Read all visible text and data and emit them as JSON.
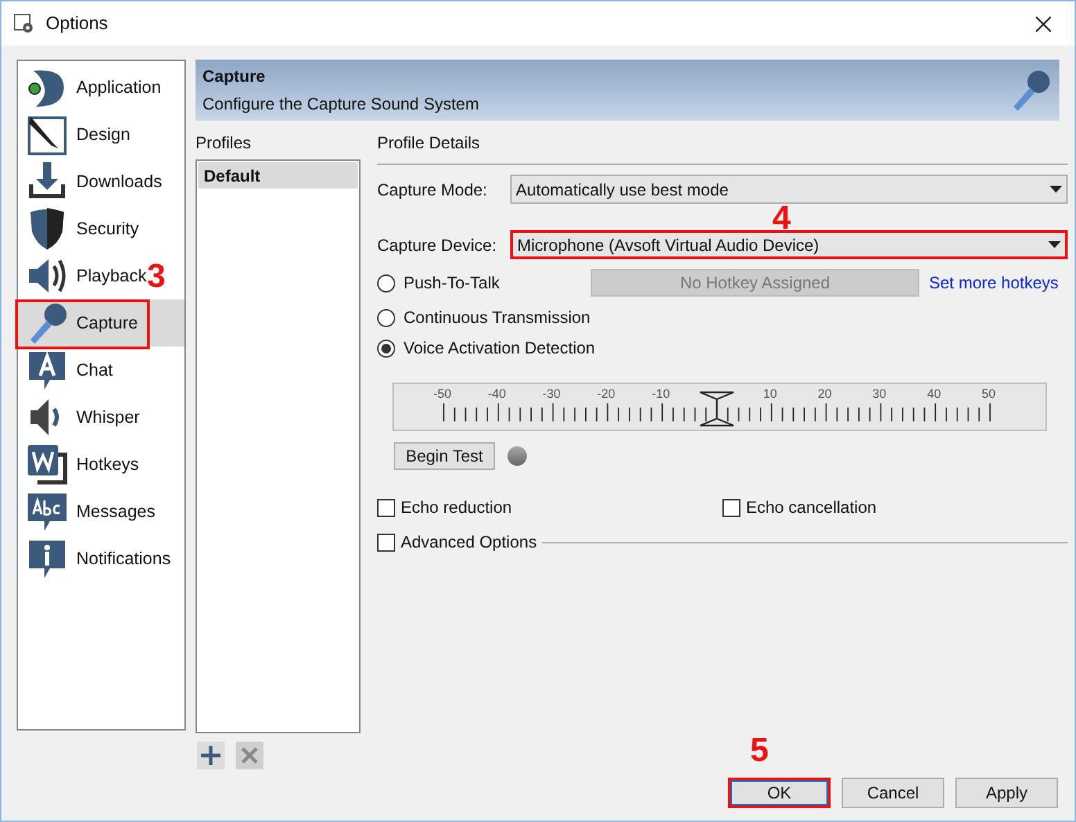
{
  "window": {
    "title": "Options"
  },
  "sidebar": {
    "items": [
      {
        "label": "Application",
        "selected": false,
        "highlighted": false
      },
      {
        "label": "Design",
        "selected": false,
        "highlighted": false
      },
      {
        "label": "Downloads",
        "selected": false,
        "highlighted": false
      },
      {
        "label": "Security",
        "selected": false,
        "highlighted": false
      },
      {
        "label": "Playback",
        "selected": false,
        "highlighted": false,
        "annotation_after": "3"
      },
      {
        "label": "Capture",
        "selected": true,
        "highlighted": true
      },
      {
        "label": "Chat",
        "selected": false,
        "highlighted": false
      },
      {
        "label": "Whisper",
        "selected": false,
        "highlighted": false
      },
      {
        "label": "Hotkeys",
        "selected": false,
        "highlighted": false
      },
      {
        "label": "Messages",
        "selected": false,
        "highlighted": false
      },
      {
        "label": "Notifications",
        "selected": false,
        "highlighted": false
      }
    ]
  },
  "header": {
    "title": "Capture",
    "subtitle": "Configure the Capture Sound System"
  },
  "profiles": {
    "label": "Profiles",
    "items": [
      {
        "label": "Default",
        "selected": true
      }
    ]
  },
  "details": {
    "label": "Profile Details",
    "capture_mode": {
      "label": "Capture Mode:",
      "value": "Automatically use best mode"
    },
    "capture_device": {
      "label": "Capture Device:",
      "value": "Microphone (Avsoft Virtual Audio Device)",
      "annotation": "4"
    },
    "transmission": [
      {
        "label": "Push-To-Talk",
        "selected": false,
        "hotkey": "No Hotkey Assigned",
        "link": "Set more hotkeys"
      },
      {
        "label": "Continuous Transmission",
        "selected": false
      },
      {
        "label": "Voice Activation Detection",
        "selected": true
      }
    ],
    "threshold": {
      "scale_labels": [
        "-50",
        "-40",
        "-30",
        "-20",
        "-10",
        "10",
        "20",
        "30",
        "40",
        "50"
      ],
      "level": 0.5
    },
    "begin_test": "Begin Test",
    "options": [
      {
        "label": "Echo reduction",
        "checked": false
      },
      {
        "label": "Echo cancellation",
        "checked": false
      }
    ],
    "advanced": {
      "label": "Advanced Options",
      "checked": false
    }
  },
  "buttons": [
    {
      "label": "OK",
      "kind": "default",
      "annotation": "5"
    },
    {
      "label": "Cancel",
      "kind": "normal"
    },
    {
      "label": "Apply",
      "kind": "normal"
    }
  ]
}
